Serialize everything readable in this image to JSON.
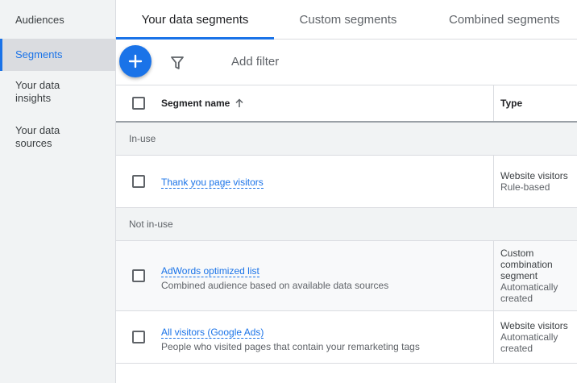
{
  "sidebar": {
    "items": [
      {
        "label": "Audiences"
      },
      {
        "label": "Segments"
      },
      {
        "label": "Your data insights"
      },
      {
        "label": "Your data sources"
      }
    ]
  },
  "tabs": [
    {
      "label": "Your data segments"
    },
    {
      "label": "Custom segments"
    },
    {
      "label": "Combined segments"
    }
  ],
  "toolbar": {
    "add_filter_label": "Add filter"
  },
  "table": {
    "columns": {
      "name": "Segment name",
      "type": "Type"
    },
    "groups": [
      {
        "label": "In-use",
        "rows": [
          {
            "name": "Thank you page visitors",
            "description": "",
            "type_lines": [
              "Website visitors",
              "Rule-based"
            ]
          }
        ]
      },
      {
        "label": "Not in-use",
        "rows": [
          {
            "name": "AdWords optimized list",
            "description": "Combined audience based on available data sources",
            "type_lines": [
              "Custom combination segment",
              "Automatically created"
            ]
          },
          {
            "name": "All visitors (Google Ads)",
            "description": "People who visited pages that contain your remarketing tags",
            "type_lines": [
              "Website visitors",
              "Automatically created"
            ]
          }
        ]
      }
    ]
  },
  "colors": {
    "accent": "#1a73e8",
    "sidebar_bg": "#f1f3f4",
    "group_bg": "#f1f3f4"
  }
}
